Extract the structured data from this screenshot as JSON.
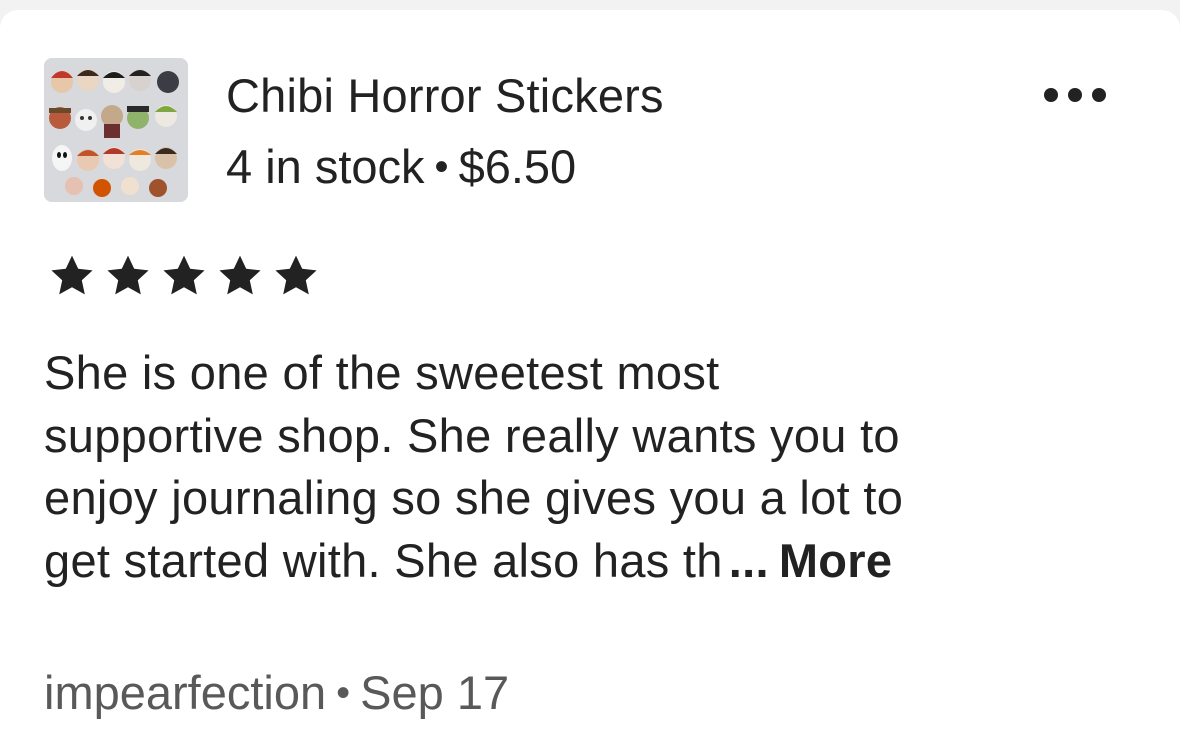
{
  "listing": {
    "title": "Chibi Horror Stickers",
    "stock": "4 in stock",
    "separator": "•",
    "price": "$6.50",
    "thumbnail_alt": "Chibi horror character sticker sheet"
  },
  "menu": {
    "icon": "more-horizontal-icon"
  },
  "review": {
    "rating": 5,
    "rating_max": 5,
    "lines": [
      "She is one of the sweetest most",
      "supportive shop. She really wants you to",
      "enjoy journaling so she gives you a lot to",
      "get started with. She  also has th"
    ],
    "ellipsis": "...",
    "more_label": "More"
  },
  "footer": {
    "username": "impearfection",
    "separator": "•",
    "date": "Sep 17"
  },
  "colors": {
    "text": "#222222",
    "muted": "#595959",
    "background": "#ffffff",
    "page_background": "#f2f2f2"
  }
}
